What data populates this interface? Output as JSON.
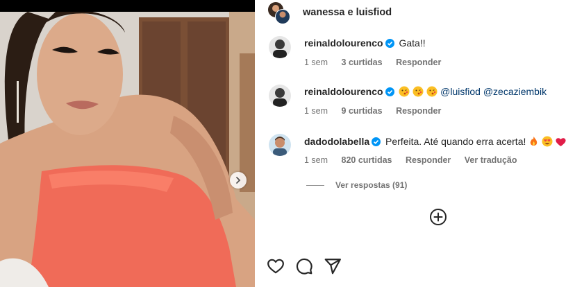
{
  "post": {
    "author_header": "wanessa e luisfiod"
  },
  "comments": [
    {
      "user": "reinaldolourenco",
      "verified": true,
      "text": "Gata!!",
      "time": "1 sem",
      "likes": "3 curtidas",
      "reply": "Responder"
    },
    {
      "user": "reinaldolourenco",
      "verified": true,
      "emojis": [
        "kissing-face-emoji",
        "kissing-face-emoji",
        "kissing-face-emoji"
      ],
      "mention1": "@luisfiod",
      "mention2": "@zecaziembik",
      "time": "1 sem",
      "likes": "9 curtidas",
      "reply": "Responder"
    },
    {
      "user": "dadodolabella",
      "verified": true,
      "text": "Perfeita. Até quando erra acerta!",
      "emojis": [
        "fire-emoji",
        "heart-eyes-emoji",
        "red-heart-emoji"
      ],
      "time": "1 sem",
      "likes": "820 curtidas",
      "reply": "Responder",
      "translate": "Ver tradução"
    }
  ],
  "view_replies": "Ver respostas (91)",
  "icons": {
    "like": "heart-icon",
    "comment": "comment-icon",
    "share": "paper-plane-icon",
    "load_more": "plus-circle-icon",
    "carousel_next": "chevron-right-icon",
    "verified": "verified-badge-icon"
  },
  "colors": {
    "text": "#262626",
    "secondary": "#737373",
    "verified": "#0095f6",
    "mention": "#00376b"
  }
}
